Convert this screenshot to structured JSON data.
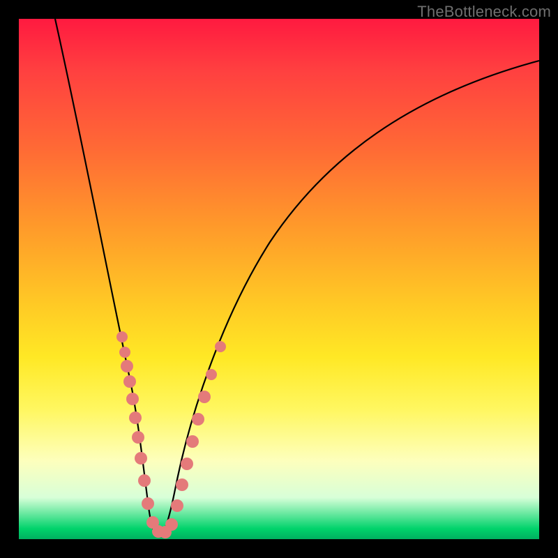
{
  "watermark": "TheBottleneck.com",
  "colors": {
    "dot": "#e47a7a",
    "curve": "#000000"
  },
  "chart_data": {
    "type": "line",
    "title": "",
    "xlabel": "",
    "ylabel": "",
    "xlim": [
      0,
      100
    ],
    "ylim": [
      0,
      100
    ],
    "grid": false,
    "description": "V-shaped bottleneck curve with minimum around x≈25 and scatter points along both arms near the trough.",
    "series": [
      {
        "name": "curve",
        "x": [
          7,
          10,
          13,
          16,
          19,
          22,
          24,
          25,
          26,
          28,
          31,
          35,
          40,
          46,
          53,
          61,
          70,
          80,
          90,
          100
        ],
        "y": [
          100,
          85,
          70,
          55,
          40,
          22,
          8,
          3,
          5,
          13,
          27,
          42,
          55,
          66,
          75,
          82,
          87,
          91,
          94,
          96
        ]
      },
      {
        "name": "scatter",
        "type": "scatter",
        "x": [
          18.5,
          19.3,
          20.4,
          21.1,
          21.7,
          22.3,
          22.9,
          23.6,
          24.2,
          24.8,
          25.3,
          25.9,
          26.4,
          27.0,
          28.3,
          29.3,
          30.1,
          30.8,
          31.8,
          33.3
        ],
        "y": [
          40,
          36,
          30,
          25,
          21,
          17,
          13,
          9,
          6,
          4,
          3,
          4,
          6,
          9,
          15,
          20,
          24,
          28,
          33,
          41
        ]
      }
    ]
  }
}
